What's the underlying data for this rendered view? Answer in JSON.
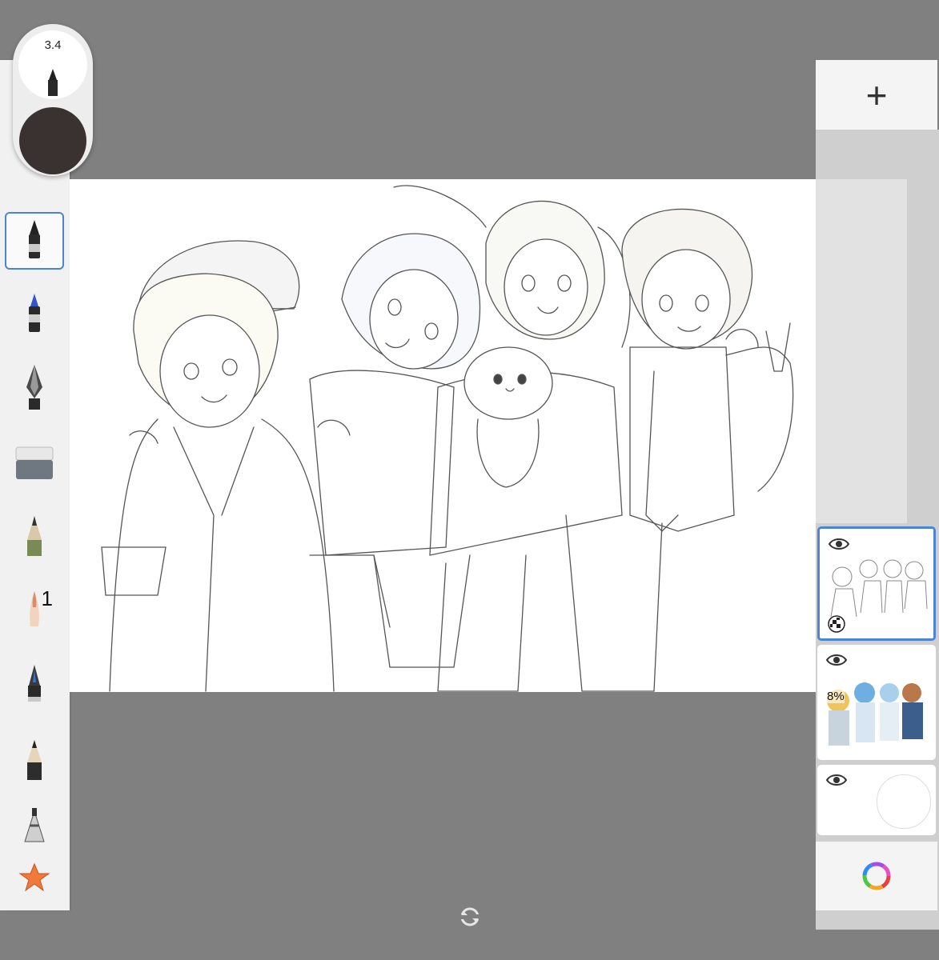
{
  "brush_puck": {
    "size_value": "3.4",
    "color": "#3a3230"
  },
  "toolbar": {
    "tools": [
      {
        "name": "ballpoint-pen",
        "selected": true
      },
      {
        "name": "marker",
        "selected": false
      },
      {
        "name": "fountain-pen",
        "selected": false
      },
      {
        "name": "eraser",
        "selected": false
      },
      {
        "name": "pencil-textured",
        "selected": false
      },
      {
        "name": "paint-brush",
        "selected": false,
        "count": "1"
      },
      {
        "name": "inking-pen",
        "selected": false
      },
      {
        "name": "hard-pencil",
        "selected": false
      },
      {
        "name": "airbrush",
        "selected": false
      },
      {
        "name": "favorites-star",
        "selected": false
      }
    ],
    "accent_color": "#4b83d6"
  },
  "layers": {
    "add_label": "+",
    "items": [
      {
        "name": "lineart-layer",
        "visible": true,
        "selected": true
      },
      {
        "name": "color-layer",
        "visible": true,
        "selected": false,
        "opacity_label": "8%"
      },
      {
        "name": "background-layer",
        "visible": true,
        "selected": false
      }
    ]
  },
  "colors": {
    "background": "#808080",
    "panel": "#f1f1f1",
    "selection": "#4b83d6"
  }
}
